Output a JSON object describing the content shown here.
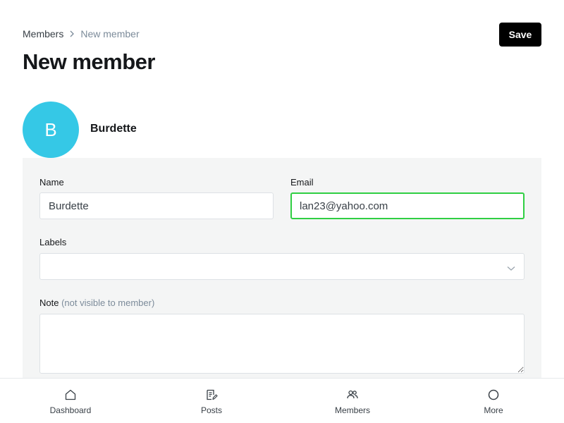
{
  "breadcrumb": {
    "parent": "Members",
    "current": "New member"
  },
  "header": {
    "title": "New member",
    "save_label": "Save"
  },
  "member": {
    "initial": "B",
    "display_name": "Burdette",
    "avatar_color": "#35c8e6"
  },
  "form": {
    "name_label": "Name",
    "name_value": "Burdette",
    "email_label": "Email",
    "email_value": "lan23@yahoo.com",
    "labels_label": "Labels",
    "note_label": "Note",
    "note_hint": "(not visible to member)",
    "note_value": ""
  },
  "nav": {
    "items": [
      {
        "label": "Dashboard",
        "icon": "home-icon"
      },
      {
        "label": "Posts",
        "icon": "post-edit-icon"
      },
      {
        "label": "Members",
        "icon": "members-icon"
      },
      {
        "label": "More",
        "icon": "circle-more-icon"
      }
    ]
  },
  "colors": {
    "accent_focus": "#30cf43",
    "panel_bg": "#f4f5f5",
    "primary_button": "#000000"
  }
}
